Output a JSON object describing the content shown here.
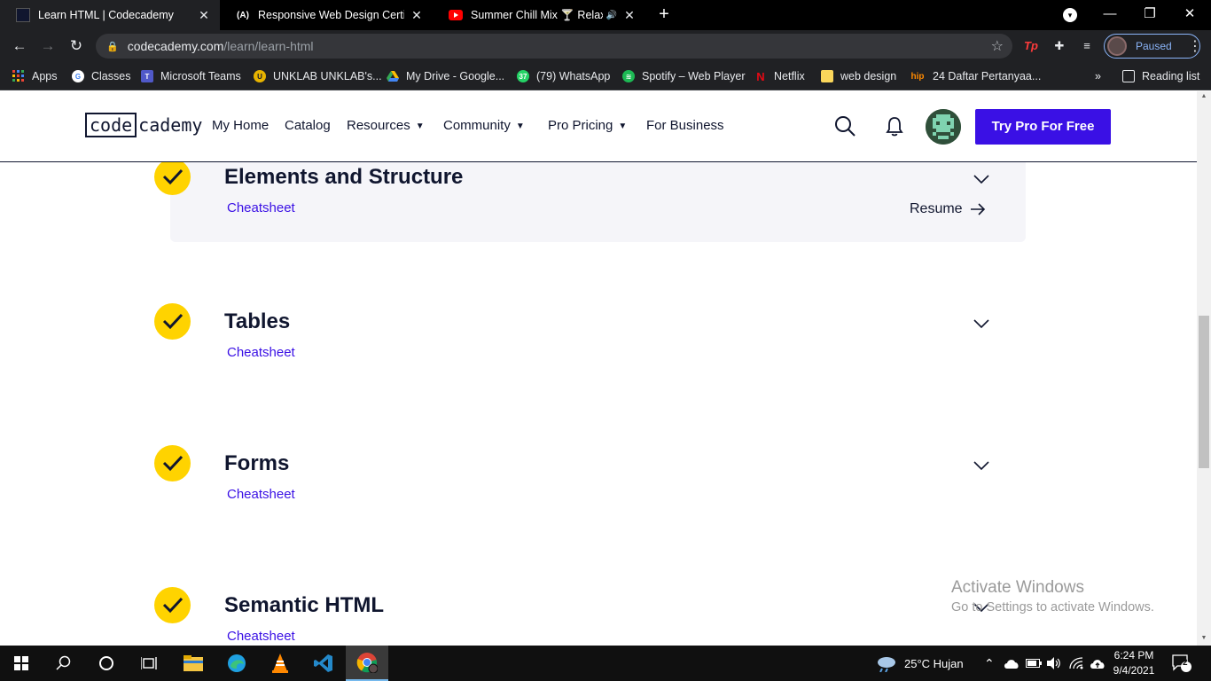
{
  "browser": {
    "tabs": [
      {
        "title": "Learn HTML | Codecademy",
        "active": true
      },
      {
        "title": "Responsive Web Design Certifica",
        "active": false
      },
      {
        "title": "Summer Chill Mix 🍸 Relaxin",
        "active": false
      }
    ],
    "url_host": "codecademy.com",
    "url_path": "/learn/learn-html",
    "profile_label": "Paused",
    "bookmarks": [
      {
        "label": "Apps",
        "icon": "apps-grid-icon"
      },
      {
        "label": "Classes",
        "icon": "google-icon"
      },
      {
        "label": "Microsoft Teams",
        "icon": "teams-icon"
      },
      {
        "label": "UNKLAB UNKLAB's...",
        "icon": "unklab-icon"
      },
      {
        "label": "My Drive - Google...",
        "icon": "google-drive-icon"
      },
      {
        "label": "(79) WhatsApp",
        "icon": "whatsapp-icon"
      },
      {
        "label": "Spotify – Web Player",
        "icon": "spotify-icon"
      },
      {
        "label": "Netflix",
        "icon": "netflix-icon"
      },
      {
        "label": "web design",
        "icon": "folder-icon"
      },
      {
        "label": "24 Daftar Pertanyaa...",
        "icon": "hip-icon"
      }
    ],
    "more_bookmarks": "»",
    "reading_list": "Reading list",
    "whatsapp_badge": "37"
  },
  "site": {
    "logo_boxed": "code",
    "logo_rest": "cademy",
    "nav": {
      "my_home": "My Home",
      "catalog": "Catalog",
      "resources": "Resources",
      "community": "Community",
      "pro_pricing": "Pro Pricing",
      "for_business": "For Business"
    },
    "cta": "Try Pro For Free"
  },
  "modules": [
    {
      "title": "Elements and Structure",
      "link": "Cheatsheet",
      "completed": true
    },
    {
      "title": "Tables",
      "link": "Cheatsheet",
      "completed": true
    },
    {
      "title": "Forms",
      "link": "Cheatsheet",
      "completed": true
    },
    {
      "title": "Semantic HTML",
      "link": "Cheatsheet",
      "completed": true
    }
  ],
  "resume_label": "Resume",
  "watermark": {
    "line1": "Activate Windows",
    "line2": "Go to Settings to activate Windows."
  },
  "taskbar": {
    "weather": "25°C  Hujan",
    "time": "6:24 PM",
    "date": "9/4/2021",
    "notifications": "2"
  },
  "colors": {
    "accent": "#3a10e5",
    "check": "#ffd300",
    "navy": "#10162f"
  }
}
